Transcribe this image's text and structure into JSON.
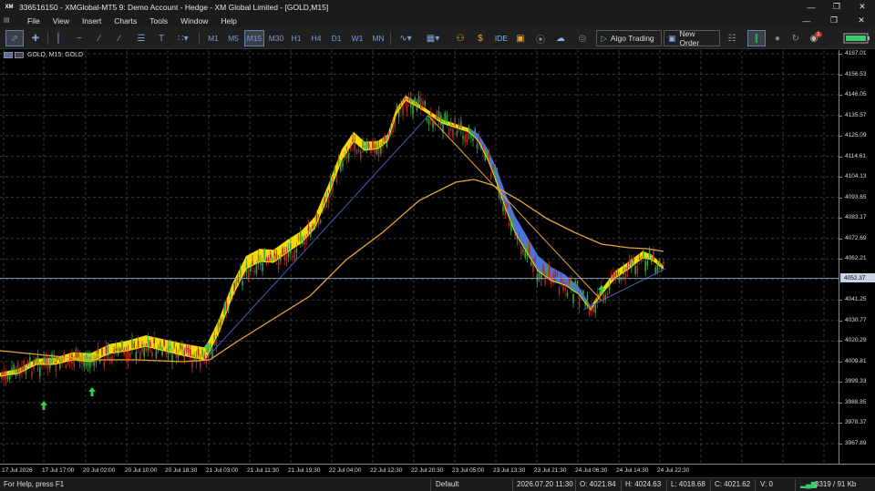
{
  "window": {
    "title": "336516150 - XMGlobal-MT5 9: Demo Account - Hedge - XM Global Limited - [GOLD,M15]",
    "logo": "XM"
  },
  "menu": [
    "File",
    "View",
    "Insert",
    "Charts",
    "Tools",
    "Window",
    "Help"
  ],
  "toolbar": {
    "timeframes": [
      "M1",
      "M5",
      "M15",
      "M30",
      "H1",
      "H4",
      "D1",
      "W1",
      "MN"
    ],
    "selected_timeframe": "M15",
    "ide_label": "IDE",
    "algo_trading_label": "Algo Trading",
    "new_order_label": "New Order",
    "notification_count": "1"
  },
  "chart": {
    "symbol_label": "GOLD, M15:  GOLD",
    "current_price": "4052.37",
    "price_labels": [
      "4167.01",
      "4156.53",
      "4146.05",
      "4135.57",
      "4125.09",
      "4114.61",
      "4104.13",
      "4093.65",
      "4083.17",
      "4072.69",
      "4062.21",
      "4041.25",
      "4030.77",
      "4020.29",
      "4009.81",
      "3999.33",
      "3988.85",
      "3978.37",
      "3967.89"
    ],
    "time_labels": [
      "17 Jul 2026",
      "17 Jul 17:00",
      "20 Jul 02:00",
      "20 Jul 10:00",
      "20 Jul 18:30",
      "21 Jul 03:00",
      "21 Jul 11:30",
      "21 Jul 19:30",
      "22 Jul 04:00",
      "22 Jul 12:30",
      "22 Jul 20:30",
      "23 Jul 05:00",
      "23 Jul 13:30",
      "23 Jul 21:30",
      "24 Jul 06:30",
      "24 Jul 14:30",
      "24 Jul 22:30"
    ],
    "colors": {
      "up_ribbon": "#f5d90a",
      "down_ribbon": "#4f74d9",
      "slow_ma": "#e8a530",
      "trend_line": "#3d5fb0",
      "candle_up": "#3aa13a",
      "candle_down": "#b3261e",
      "arrow": "#2fd34a",
      "grid": "#3a3a3a"
    }
  },
  "status": {
    "help": "For Help, press F1",
    "profile": "Default",
    "datetime": "2026.07.20 11:30",
    "open": "O: 4021.84",
    "high": "H: 4024.63",
    "low": "L: 4018.68",
    "close": "C: 4021.62",
    "volume": "V: 0",
    "traffic": "3319 / 91 Kb"
  }
}
